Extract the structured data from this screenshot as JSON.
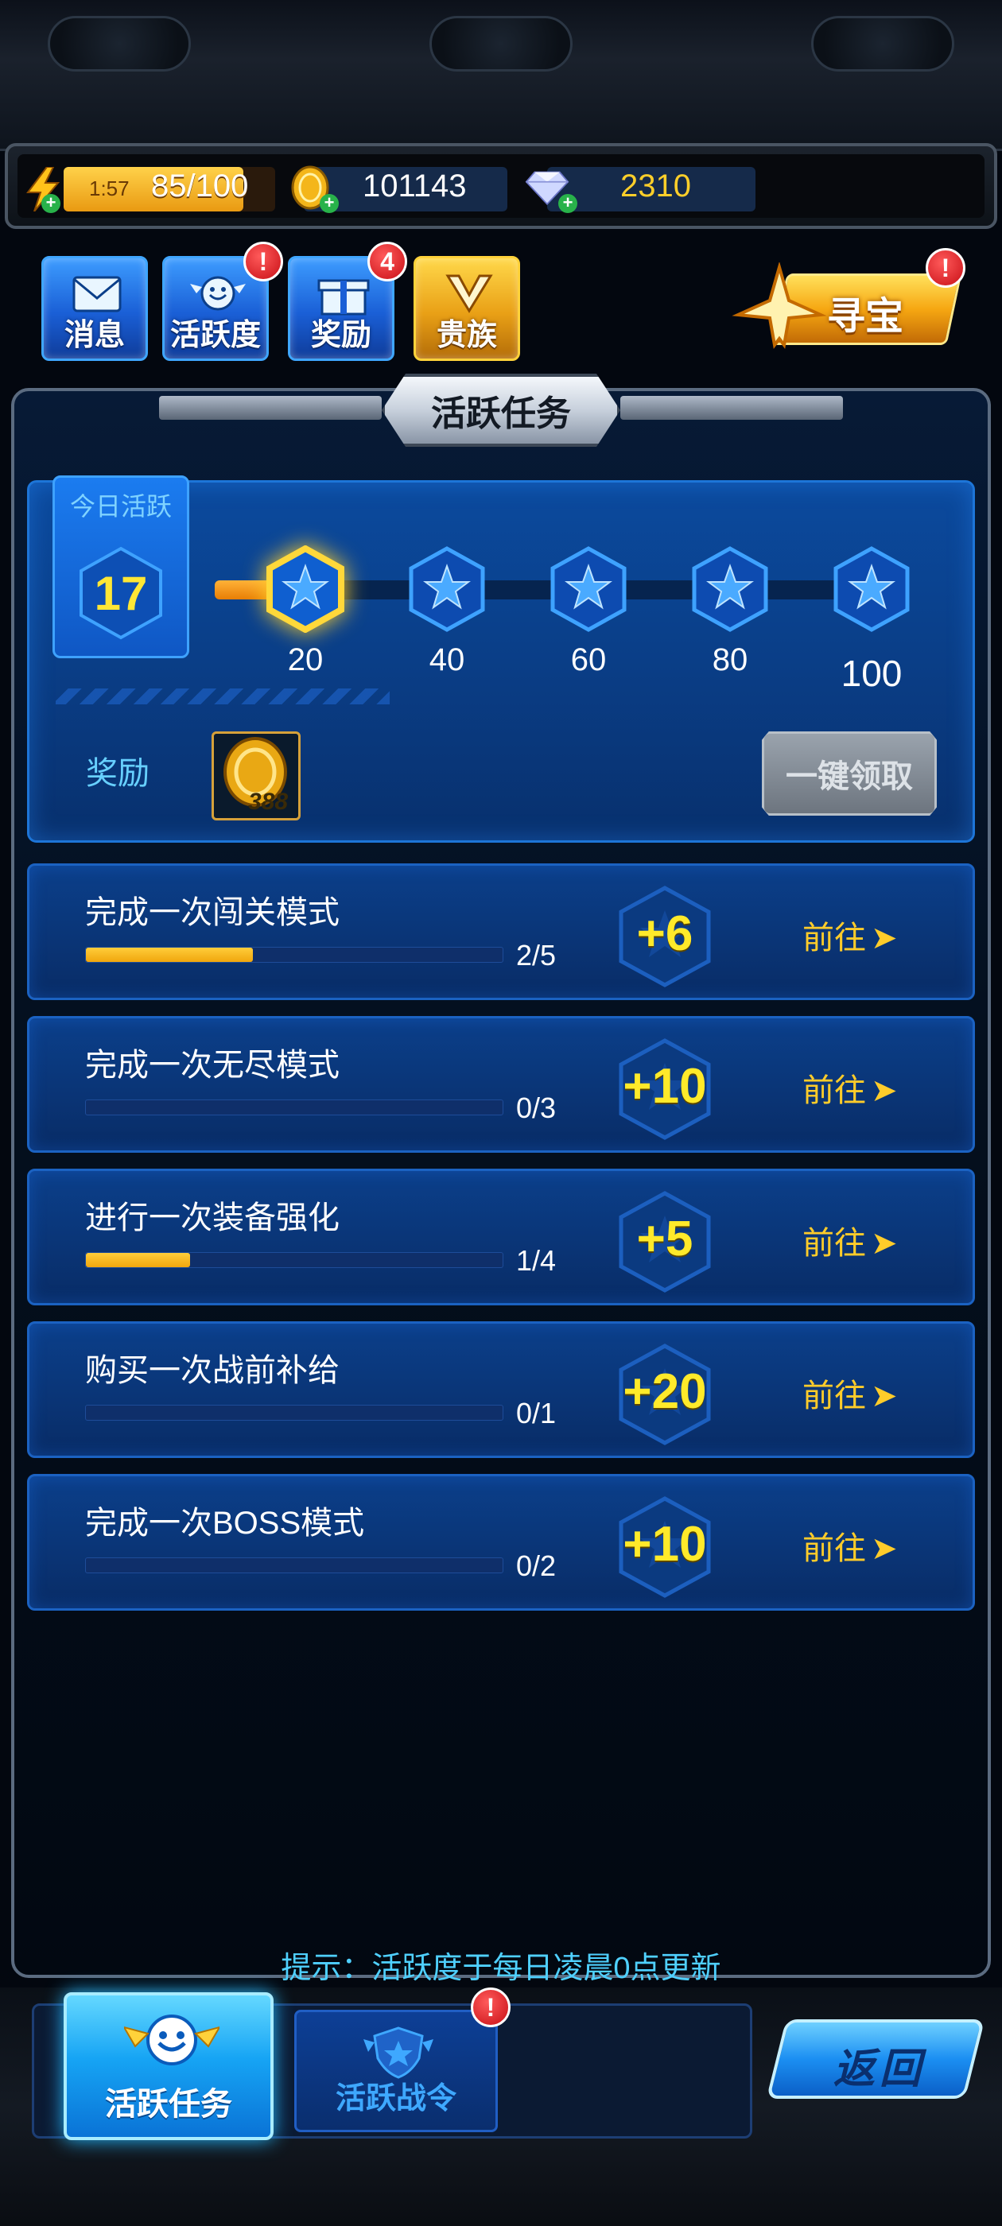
{
  "resources": {
    "energy_timer": "1:57",
    "energy": "85/100",
    "energy_fill": 0.85,
    "coins": "101143",
    "diamonds": "2310"
  },
  "nav": {
    "items": [
      {
        "label": "消息",
        "badge": ""
      },
      {
        "label": "活跃度",
        "badge": "!"
      },
      {
        "label": "奖励",
        "badge": "4"
      },
      {
        "label": "贵族",
        "badge": ""
      }
    ],
    "treasure": {
      "label": "寻宝",
      "badge": "!"
    }
  },
  "panel": {
    "title": "活跃任务"
  },
  "activity": {
    "today_label": "今日活跃",
    "today_value": "17",
    "max": 100,
    "milestones": [
      "20",
      "40",
      "60",
      "80",
      "100"
    ],
    "reward_label": "奖励",
    "reward_amount": "388",
    "claim_all_label": "一键领取"
  },
  "tasks": [
    {
      "name": "完成一次闯关模式",
      "count": "2/5",
      "progress": 0.4,
      "points": "+6",
      "go": "前往"
    },
    {
      "name": "完成一次无尽模式",
      "count": "0/3",
      "progress": 0,
      "points": "+10",
      "go": "前往"
    },
    {
      "name": "进行一次装备强化",
      "count": "1/4",
      "progress": 0.25,
      "points": "+5",
      "go": "前往"
    },
    {
      "name": "购买一次战前补给",
      "count": "0/1",
      "progress": 0,
      "points": "+20",
      "go": "前往"
    },
    {
      "name": "完成一次BOSS模式",
      "count": "0/2",
      "progress": 0,
      "points": "+10",
      "go": "前往"
    }
  ],
  "tip": "提示：活跃度于每日凌晨0点更新",
  "tabs": {
    "active_task": "活跃任务",
    "battle_pass": "活跃战令",
    "battle_pass_badge": "!"
  },
  "back_label": "返回",
  "colors": {
    "accent_gold": "#ffea2a",
    "accent_blue": "#1b62c2",
    "alert_red": "#c80f16"
  }
}
